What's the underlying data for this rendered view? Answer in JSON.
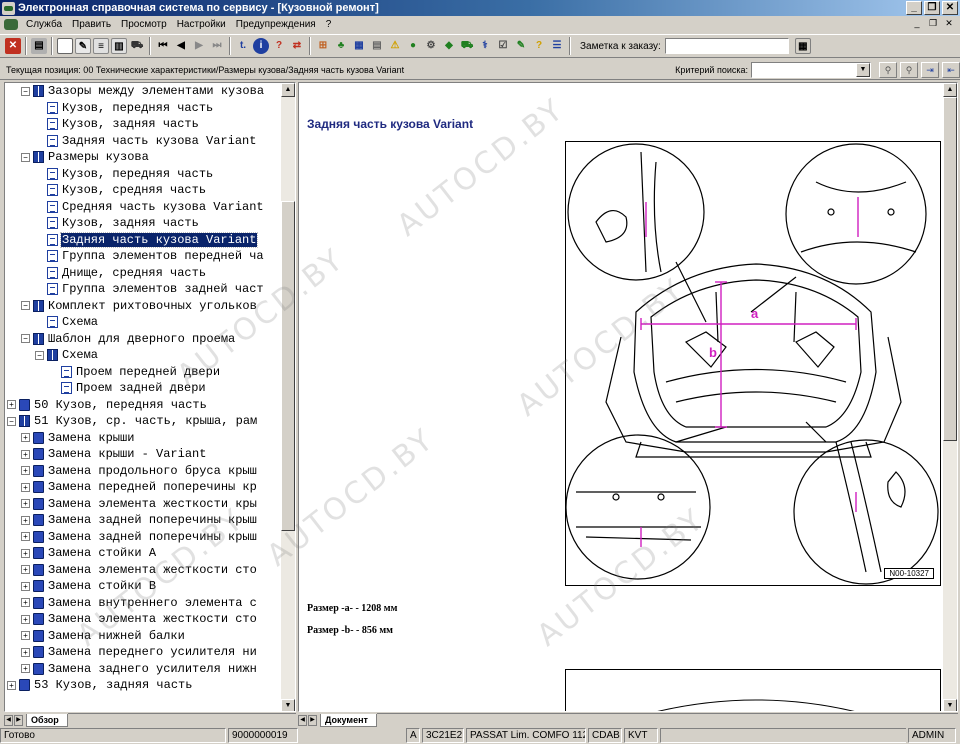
{
  "window": {
    "title": "Электронная справочная система по сервису - [Кузовной ремонт]",
    "controls": [
      "_",
      "❐",
      "✕"
    ]
  },
  "menu": {
    "items": [
      "Служба",
      "Править",
      "Просмотр",
      "Настройки",
      "Предупреждения",
      "?"
    ],
    "mdi_controls": [
      "_",
      "❐",
      "✕"
    ]
  },
  "toolbar": {
    "order_note_label": "Заметка к заказу:",
    "order_note_value": ""
  },
  "position_bar": {
    "current_position": "Текущая позиция: 00 Технические характеристики/Размеры кузова/Задняя часть кузова Variant",
    "search_label": "Критерий поиска:",
    "search_value": ""
  },
  "tree": {
    "items": [
      {
        "label": "Зазоры между элементами кузова",
        "level": 2,
        "icon": "book-open",
        "expander": "−"
      },
      {
        "label": "Кузов, передняя часть",
        "level": 3,
        "icon": "page"
      },
      {
        "label": "Кузов, задняя часть",
        "level": 3,
        "icon": "page"
      },
      {
        "label": "Задняя часть кузова Variant",
        "level": 3,
        "icon": "page"
      },
      {
        "label": "Размеры кузова",
        "level": 2,
        "icon": "book-open",
        "expander": "−"
      },
      {
        "label": "Кузов, передняя часть",
        "level": 3,
        "icon": "page"
      },
      {
        "label": "Кузов, средняя часть",
        "level": 3,
        "icon": "page"
      },
      {
        "label": "Средняя часть кузова Variant",
        "level": 3,
        "icon": "page"
      },
      {
        "label": "Кузов, задняя часть",
        "level": 3,
        "icon": "page"
      },
      {
        "label": "Задняя часть кузова Variant",
        "level": 3,
        "icon": "page",
        "selected": true
      },
      {
        "label": "Группа элементов передней ча",
        "level": 3,
        "icon": "page"
      },
      {
        "label": "Днище, средняя часть",
        "level": 3,
        "icon": "page"
      },
      {
        "label": "Группа элементов задней част",
        "level": 3,
        "icon": "page"
      },
      {
        "label": "Комплект рихтовочных угольков",
        "level": 2,
        "icon": "book-open",
        "expander": "−"
      },
      {
        "label": "Схема",
        "level": 3,
        "icon": "page"
      },
      {
        "label": "Шаблон для дверного проема",
        "level": 2,
        "icon": "book-open",
        "expander": "−"
      },
      {
        "label": "Схема",
        "level": 3,
        "icon": "book-open",
        "expander": "−"
      },
      {
        "label": "Проем передней двери",
        "level": 4,
        "icon": "page"
      },
      {
        "label": "Проем задней двери",
        "level": 4,
        "icon": "page"
      },
      {
        "label": "50 Кузов, передняя часть",
        "level": 1,
        "icon": "book-closed",
        "expander": "+"
      },
      {
        "label": "51 Кузов, ср. часть, крыша, рам",
        "level": 1,
        "icon": "book-open",
        "expander": "−"
      },
      {
        "label": "Замена крыши",
        "level": 2,
        "icon": "book-closed",
        "expander": "+"
      },
      {
        "label": "Замена крыши - Variant",
        "level": 2,
        "icon": "book-closed",
        "expander": "+"
      },
      {
        "label": "Замена продольного бруса крыш",
        "level": 2,
        "icon": "book-closed",
        "expander": "+"
      },
      {
        "label": "Замена передней поперечины кр",
        "level": 2,
        "icon": "book-closed",
        "expander": "+"
      },
      {
        "label": "Замена элемента жесткости кры",
        "level": 2,
        "icon": "book-closed",
        "expander": "+"
      },
      {
        "label": "Замена задней поперечины крыш",
        "level": 2,
        "icon": "book-closed",
        "expander": "+"
      },
      {
        "label": "Замена задней поперечины крыш",
        "level": 2,
        "icon": "book-closed",
        "expander": "+"
      },
      {
        "label": "Замена стойки А",
        "level": 2,
        "icon": "book-closed",
        "expander": "+"
      },
      {
        "label": "Замена элемента жесткости сто",
        "level": 2,
        "icon": "book-closed",
        "expander": "+"
      },
      {
        "label": "Замена стойки В",
        "level": 2,
        "icon": "book-closed",
        "expander": "+"
      },
      {
        "label": "Замена внутреннего элемента с",
        "level": 2,
        "icon": "book-closed",
        "expander": "+"
      },
      {
        "label": "Замена элемента жесткости сто",
        "level": 2,
        "icon": "book-closed",
        "expander": "+"
      },
      {
        "label": "Замена нижней балки",
        "level": 2,
        "icon": "book-closed",
        "expander": "+"
      },
      {
        "label": "Замена переднего усилителя ни",
        "level": 2,
        "icon": "book-closed",
        "expander": "+"
      },
      {
        "label": "Замена заднего усилителя нижн",
        "level": 2,
        "icon": "book-closed",
        "expander": "+"
      },
      {
        "label": "53 Кузов, задняя часть",
        "level": 1,
        "icon": "book-closed",
        "expander": "+"
      }
    ]
  },
  "document": {
    "heading": "Задняя часть кузова Variant",
    "figure_code": "N00-10327",
    "label_a": "a",
    "label_b": "b",
    "dimension_a": "Размер -a- - 1208 мм",
    "dimension_b": "Размер -b- - 856 мм"
  },
  "tabs": {
    "left": "Обзор",
    "right": "Документ"
  },
  "status": {
    "ready": "Готово",
    "number": "9000000019",
    "mode": "A",
    "code": "3C21E2",
    "model": "PASSAT Lim. COMFO 112",
    "engine": "CDAB",
    "gearbox": "KVT",
    "user": "ADMIN"
  },
  "watermark": "AUTOCD.BY",
  "colors": {
    "titlebar_start": "#0a246a",
    "selection": "#0a246a",
    "heading": "#1f2a80",
    "dimension_lines": "#d020c0"
  }
}
